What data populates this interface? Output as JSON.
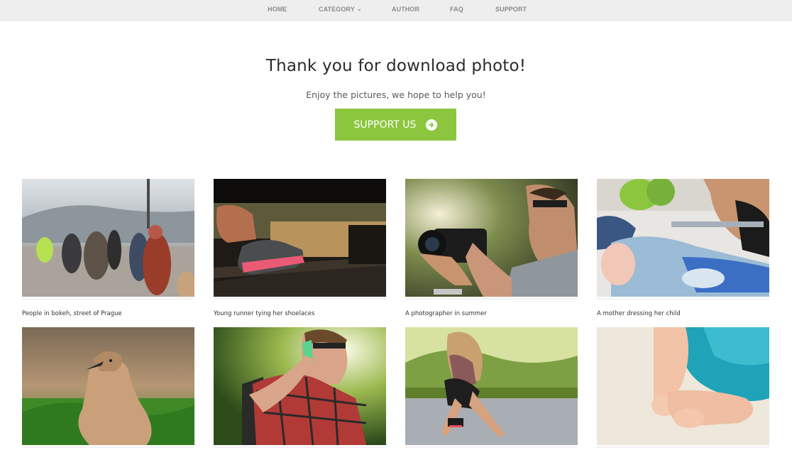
{
  "nav": {
    "items": [
      {
        "label": "HOME"
      },
      {
        "label": "CATEGORY",
        "has_dropdown": true
      },
      {
        "label": "AUTHOR"
      },
      {
        "label": "FAQ"
      },
      {
        "label": "SUPPORT"
      }
    ]
  },
  "hero": {
    "title": "Thank you for download photo!",
    "subtitle": "Enjoy the pictures, we hope to help you!",
    "button_label": "SUPPORT US",
    "button_icon": "arrow-right-circle-icon",
    "button_color": "#8cc63f"
  },
  "gallery": {
    "photos": [
      {
        "caption": "People in bokeh, street of Prague"
      },
      {
        "caption": "Young runner tying her shoelaces"
      },
      {
        "caption": "A photographer in summer"
      },
      {
        "caption": "A mother dressing her child"
      },
      {
        "caption": ""
      },
      {
        "caption": ""
      },
      {
        "caption": ""
      },
      {
        "caption": ""
      }
    ]
  }
}
